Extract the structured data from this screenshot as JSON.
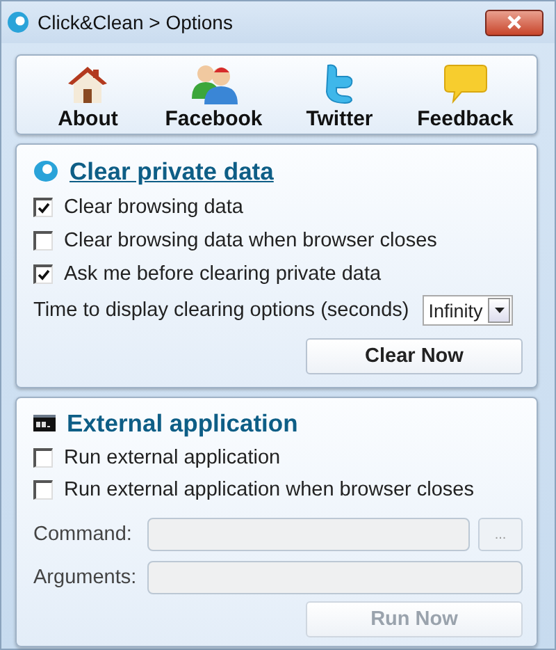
{
  "window": {
    "title": "Click&Clean > Options"
  },
  "toolbar": [
    {
      "label": "About",
      "kind": "house"
    },
    {
      "label": "Facebook",
      "kind": "people"
    },
    {
      "label": "Twitter",
      "kind": "bird"
    },
    {
      "label": "Feedback",
      "kind": "speech"
    }
  ],
  "clear_private_data": {
    "title": "Clear private data",
    "options": [
      {
        "label": "Clear browsing data",
        "checked": true
      },
      {
        "label": "Clear browsing data when browser closes",
        "checked": false
      },
      {
        "label": "Ask me before clearing private data",
        "checked": true
      }
    ],
    "timeout": {
      "label": "Time to display clearing options (seconds)",
      "value": "Infinity"
    },
    "button": {
      "label": "Clear Now",
      "disabled": false
    }
  },
  "external_application": {
    "title": "External application",
    "options": [
      {
        "label": "Run external application",
        "checked": false
      },
      {
        "label": "Run external application when browser closes",
        "checked": false
      }
    ],
    "command": {
      "label": "Command:",
      "disabled": true
    },
    "browse_button": {
      "label": "...",
      "disabled": true
    },
    "arguments": {
      "label": "Arguments:",
      "disabled": true
    },
    "button": {
      "label": "Run Now",
      "disabled": true
    }
  }
}
